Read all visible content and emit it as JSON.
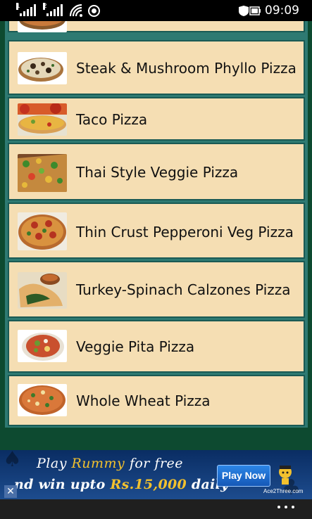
{
  "status_bar": {
    "sim1_label": "1",
    "sim2_label": "2",
    "time": "09:09",
    "icons": [
      "signal-icon",
      "wifi-icon",
      "record-icon",
      "battery-icon"
    ]
  },
  "list": {
    "items": [
      {
        "label": "",
        "thumb": "pizza-thumbnail"
      },
      {
        "label": "Steak & Mushroom Phyllo Pizza",
        "thumb": "pizza-thumbnail"
      },
      {
        "label": "Taco Pizza",
        "thumb": "pizza-thumbnail"
      },
      {
        "label": "Thai Style Veggie Pizza",
        "thumb": "pizza-thumbnail"
      },
      {
        "label": "Thin Crust Pepperoni Veg Pizza",
        "thumb": "pizza-thumbnail"
      },
      {
        "label": "Turkey-Spinach Calzones Pizza",
        "thumb": "pizza-thumbnail"
      },
      {
        "label": "Veggie Pita Pizza",
        "thumb": "pizza-thumbnail"
      },
      {
        "label": "Whole Wheat Pizza",
        "thumb": "pizza-thumbnail"
      }
    ]
  },
  "ad": {
    "line1_a": "Play ",
    "line1_b": "Rummy",
    "line1_c": " for free",
    "line2_a": "nd win upto ",
    "line2_b": "Rs.15,000",
    "line2_c": " daily",
    "button_label": "Play Now",
    "logo_text": "Ace2Three.com",
    "close_label": "✕"
  },
  "app_bar": {
    "icon": "more-icon"
  },
  "colors": {
    "item_bg": "#f5deb3",
    "list_bg": "#2e7a72",
    "frame_bg": "#0d4a30"
  }
}
